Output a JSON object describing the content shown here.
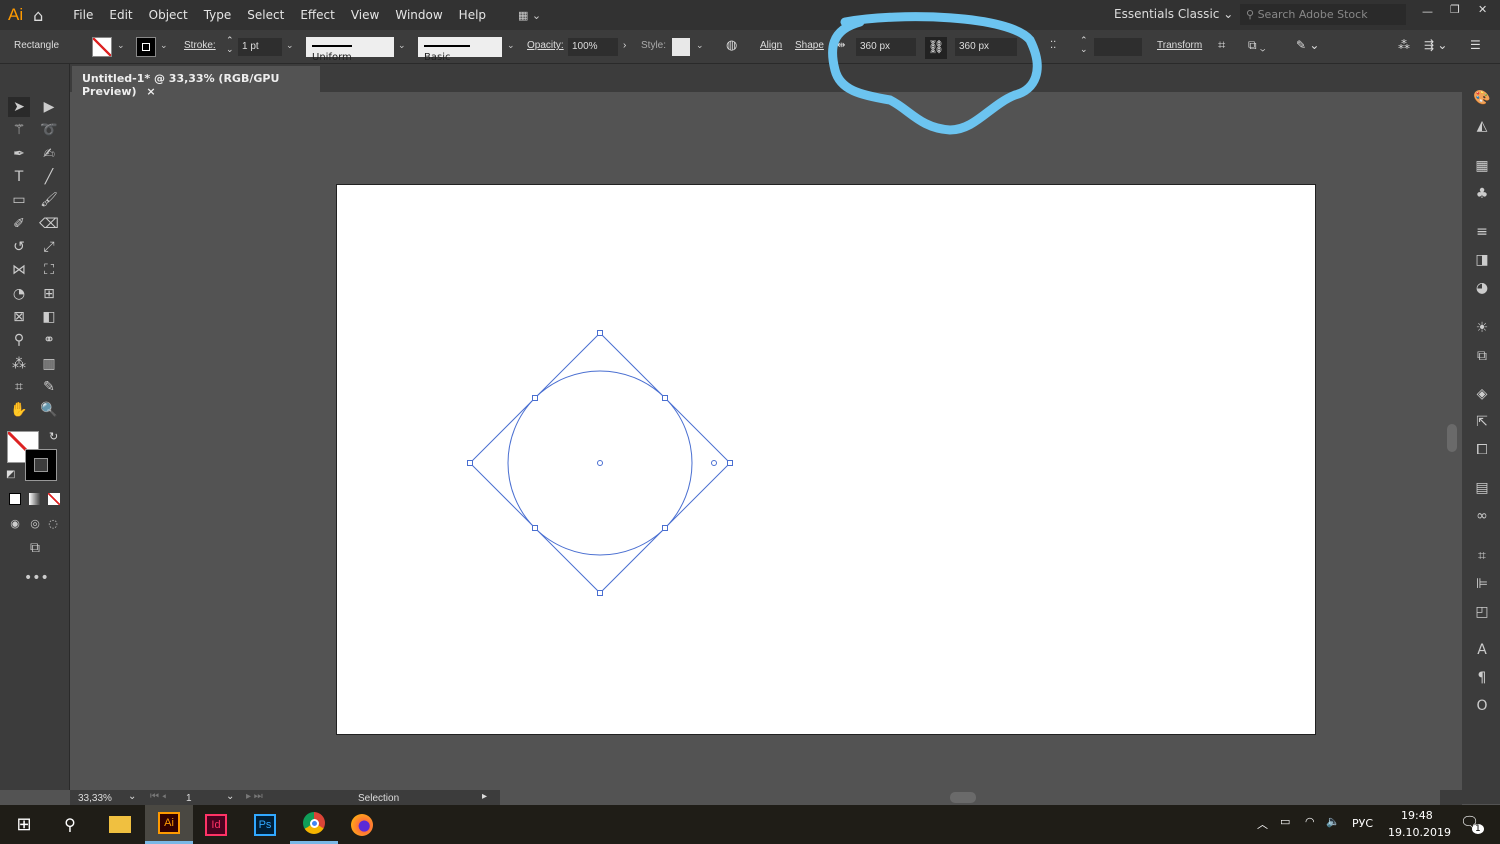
{
  "app": {
    "logo": "Ai",
    "menu": [
      "File",
      "Edit",
      "Object",
      "Type",
      "Select",
      "Effect",
      "View",
      "Window",
      "Help"
    ],
    "workspace": "Essentials Classic",
    "search_placeholder": "Search Adobe Stock"
  },
  "control": {
    "object_type": "Rectangle",
    "stroke_label": "Stroke:",
    "stroke_weight": "1 pt",
    "profile": "Uniform",
    "brush": "Basic",
    "opacity_label": "Opacity:",
    "opacity": "100%",
    "style_label": "Style:",
    "align": "Align",
    "shape": "Shape",
    "width": "360 px",
    "height": "360 px",
    "transform": "Transform"
  },
  "document": {
    "tab_title": "Untitled-1* @ 33,33% (RGB/GPU Preview)",
    "close": "×"
  },
  "status": {
    "zoom": "33,33%",
    "artboard": "1",
    "tool": "Selection"
  },
  "taskbar": {
    "apps": [
      "Ai",
      "Id",
      "Ps"
    ],
    "lang": "РУС",
    "time": "19:48",
    "date": "19.10.2019",
    "notif": "1"
  },
  "colors": {
    "selection": "#4a6fd1",
    "annotation": "#6cc4f0",
    "ai": "#ff9a00",
    "id": "#ff3366",
    "ps": "#31a8ff"
  }
}
